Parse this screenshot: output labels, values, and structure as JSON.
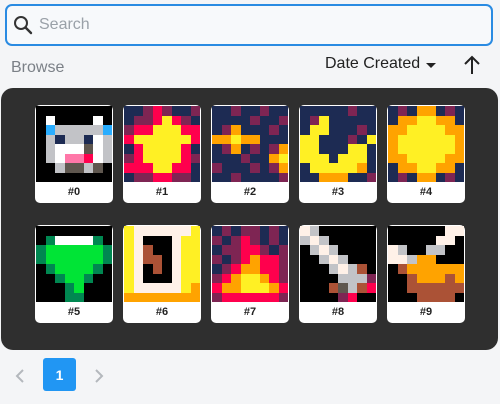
{
  "search": {
    "placeholder": "Search",
    "value": ""
  },
  "browse_label": "Browse",
  "sort": {
    "label": "Date Created",
    "direction": "ascending"
  },
  "items": [
    {
      "label": "#0",
      "art": "robot-icon",
      "palette": {
        "0": "#000000",
        "w": "#ffffff",
        "g": "#c2c3c7",
        "d": "#5f574f",
        "b": "#29adff",
        "n": "#1d2b53",
        "p": "#ff77a8",
        "r": "#ff004d"
      },
      "pixels": [
        "00000000",
        "0w0000w0",
        "0bgggggb",
        "0gnggnwg",
        "0gwwwdwg",
        "0gwpprwg",
        "00gddgd0",
        "00000000"
      ]
    },
    {
      "label": "#1",
      "art": "burst-icon",
      "palette": {
        "0": "#000000",
        "n": "#1d2b53",
        "m": "#7e2553",
        "r": "#ff004d",
        "y": "#fff024",
        "o": "#ffa300"
      },
      "pixels": [
        "nnmrmnnm",
        "nmmryrmn",
        "mrryyyrr",
        "ryyyyyyr",
        "nryyyyrn",
        "mryyyyrm",
        "rrryyrrn",
        "nmmrrmmn"
      ]
    },
    {
      "label": "#2",
      "art": "stars-icon",
      "palette": {
        "0": "#000000",
        "n": "#1d2b53",
        "m": "#7e2553",
        "r": "#ff004d",
        "y": "#fff024",
        "o": "#ffa300"
      },
      "pixels": [
        "nnmnnmnn",
        "nnnnmnnm",
        "nmonnnmn",
        "ooyoonnn",
        "nmonmnmo",
        "nnnmnnoy",
        "mnnnmnmo",
        "nnmnnnnm"
      ]
    },
    {
      "label": "#3",
      "art": "moon-icon",
      "palette": {
        "0": "#000000",
        "n": "#1d2b53",
        "m": "#7e2553",
        "y": "#fff024",
        "o": "#ffa300"
      },
      "pixels": [
        "nnnnnmnn",
        "nmynnnnn",
        "nyynnnmn",
        "yynnnmny",
        "yynnnyyn",
        "yyynyyyn",
        "nyyyyyon",
        "nnooonnm"
      ]
    },
    {
      "label": "#4",
      "art": "sun-icon",
      "palette": {
        "0": "#000000",
        "n": "#1d2b53",
        "m": "#7e2553",
        "y": "#fff024",
        "o": "#ffa300"
      },
      "pixels": [
        "nmnoonmn",
        "nooyyoon",
        "ooyyyyoo",
        "oyyyyyyo",
        "oyyyyyyo",
        "ooyyyyoo",
        "nooyyoon",
        "nmnoonmn"
      ]
    },
    {
      "label": "#5",
      "art": "gem-icon",
      "palette": {
        "0": "#000000",
        "w": "#ffffff",
        "l": "#00e436",
        "k": "#008751"
      },
      "pixels": [
        "00000000",
        "0kwwwwk0",
        "kllllllk",
        "kllllllk",
        "0kllllk0",
        "00kllk00",
        "000kl000",
        "000kk000"
      ]
    },
    {
      "label": "#6",
      "art": "door-icon",
      "palette": {
        "0": "#000000",
        "w": "#fff1e8",
        "y": "#fff024",
        "o": "#ffa300",
        "d": "#5f574f",
        "s": "#ab5236"
      },
      "pixels": [
        "ywwwwwwy",
        "yw000wyy",
        "yws00wyy",
        "ywss0wyy",
        "yw0s0wyy",
        "yw000wyy",
        "ywwwwwyo",
        "oooooooo"
      ]
    },
    {
      "label": "#7",
      "art": "fire-icon",
      "palette": {
        "0": "#000000",
        "n": "#1d2b53",
        "m": "#7e2553",
        "r": "#ff004d",
        "y": "#fff024",
        "o": "#ffa300"
      },
      "pixels": [
        "nmnmmnmn",
        "mnmrmnmn",
        "nmmrrmnm",
        "mnmrorrm",
        "nmroorrm",
        "mroyyorm",
        "rooyyyor",
        "mrrrrrrm"
      ]
    },
    {
      "label": "#8",
      "art": "sword-icon",
      "palette": {
        "0": "#000000",
        "w": "#fff1e8",
        "g": "#c2c3c7",
        "d": "#5f574f",
        "r": "#ff004d",
        "s": "#ab5236",
        "m": "#7e2553"
      },
      "pixels": [
        "wg000000",
        "gwg00000",
        "0gwg0000",
        "00gwg000",
        "000gwgs0",
        "0000gggm",
        "000sdgsr",
        "0000mr00"
      ]
    },
    {
      "label": "#9",
      "art": "meat-icon",
      "palette": {
        "0": "#000000",
        "w": "#fff1e8",
        "g": "#c2c3c7",
        "o": "#ffa300",
        "s": "#ab5236",
        "d": "#5f574f"
      },
      "pixels": [
        "000000ww",
        "00000ww0",
        "wg00gg00",
        "wwgoo000",
        "0soooooo",
        "00soooso",
        "00ssssss",
        "000ssss0"
      ]
    }
  ],
  "pagination": {
    "current_page": "1",
    "prev_icon": "chevron-left-icon",
    "next_icon": "chevron-right-icon"
  },
  "colors": {
    "accent": "#2196f3",
    "focus_border": "#2a8be2",
    "gallery_bg": "#2f2f2f"
  }
}
